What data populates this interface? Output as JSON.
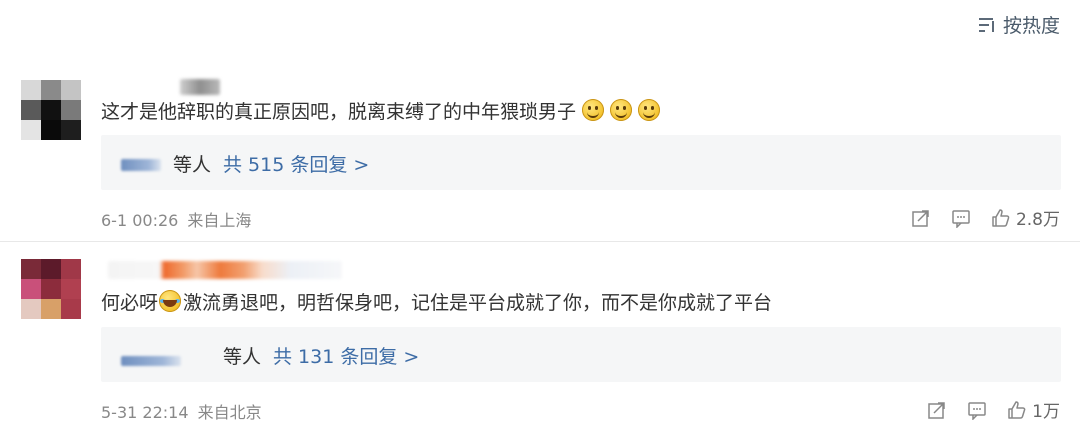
{
  "sort": {
    "icon": "sort-lines-icon",
    "label": "按热度"
  },
  "comments": [
    {
      "text": "这才是他辞职的真正原因吧，脱离束缚了的中年猥琐男子",
      "emojis": [
        "smile-emoji",
        "smile-emoji",
        "smile-emoji"
      ],
      "replies_suffix": "等人",
      "replies_count": "共 515 条回复 >",
      "time": "6-1 00:26",
      "location": "来自上海",
      "likes": "2.8万"
    },
    {
      "text_before": "何必呀",
      "text_after": "激流勇退吧，明哲保身吧，记住是平台成就了你，而不是你成就了平台",
      "emoji": "laugh-cry-emoji",
      "replies_suffix": "等人",
      "replies_count": "共 131 条回复 >",
      "time": "5-31 22:14",
      "location": "来自北京",
      "likes": "1万"
    }
  ]
}
